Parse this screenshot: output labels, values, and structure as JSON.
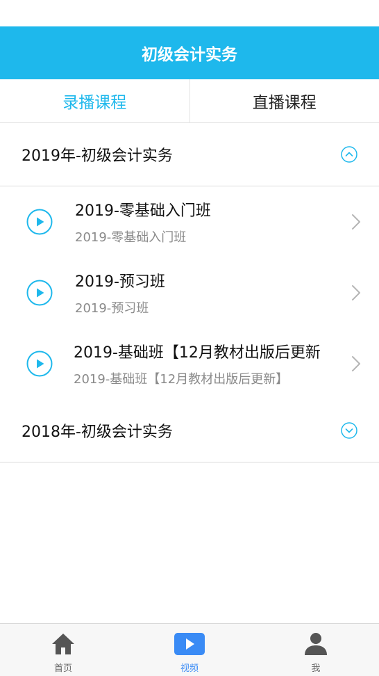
{
  "header": {
    "title": "初级会计实务"
  },
  "tabs": [
    {
      "label": "录播课程",
      "active": true
    },
    {
      "label": "直播课程",
      "active": false
    }
  ],
  "groups": [
    {
      "title": "2019年-初级会计实务",
      "expanded": true,
      "courses": [
        {
          "title": "2019-零基础入门班",
          "subtitle": "2019-零基础入门班"
        },
        {
          "title": "2019-预习班",
          "subtitle": "2019-预习班"
        },
        {
          "title": "2019-基础班【12月教材出版后更新",
          "subtitle": "2019-基础班【12月教材出版后更新】"
        }
      ]
    },
    {
      "title": "2018年-初级会计实务",
      "expanded": false
    }
  ],
  "bottom_nav": [
    {
      "label": "首页",
      "icon": "home-icon"
    },
    {
      "label": "视频",
      "icon": "video-play-icon",
      "active": true
    },
    {
      "label": "我",
      "icon": "user-icon"
    }
  ],
  "colors": {
    "accent": "#1EB8EC",
    "nav_active": "#3A8BF5",
    "nav_inactive": "#666666"
  }
}
